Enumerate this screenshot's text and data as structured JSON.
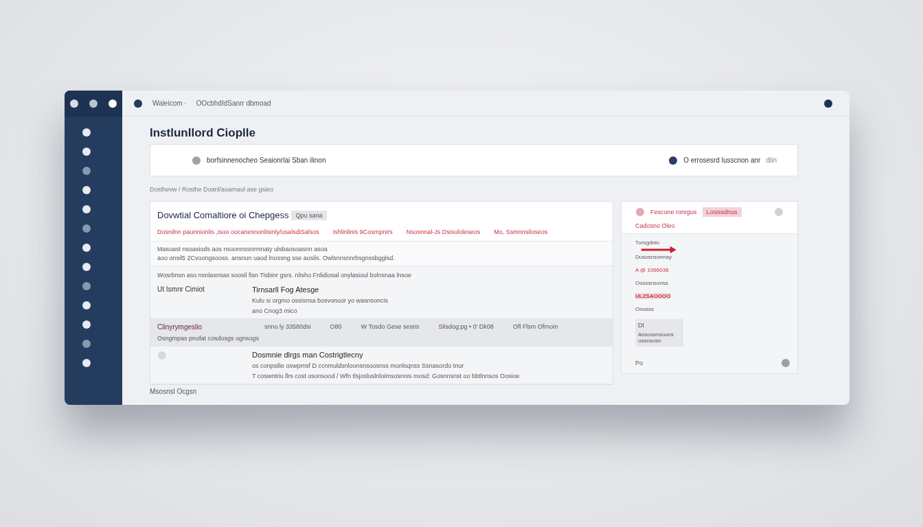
{
  "topbar": {
    "breadcrumb": [
      "Waleicom ·",
      "OOcbhdIdSanrr dbmoad"
    ]
  },
  "title": "Instlunllord Cioplle",
  "search": {
    "placeholder": "borfsinnenocheo Seaionrlai Sban ilinon",
    "status": "O errosesrd lusscnon anr",
    "status_note": "dlin"
  },
  "subtitle": "Dosthevw / Rosthe Doanl/aoarnaul ase gsieo",
  "main": {
    "heading": "Dovwtial Comaltiore oi Chepgess",
    "chip": "Qpu sana",
    "alert_items": [
      "Dosnilnn paunnionlis ,isoo oocanesnonlisinly/usalsdiSalsos",
      "Ishlinlinis 9Cosmpnirs",
      "Nsosnnal-Js Dsisuloleseos",
      "Mo, Ssmnnsiloseos"
    ],
    "notice_lines": [
      "Masoast nsoasiods aos nsoonnssnrmnaty ulsbaosoasnn asoa",
      "aoo onsil5 2Cvoongsooss. ansnun uaod lnossng sse aoslis. Owlsnnsnnrbsgnssbgglsd."
    ],
    "section_label": "Wosrbnsn aso nsnlasnsas soosil fisn Tisbinr gsrs. nlisho Fnlidiosal onylasioul bolnsnaa lnsoe",
    "rows": [
      {
        "kind": "message",
        "selected": false,
        "label": "Ut Ismnr Cimiot",
        "title": "Tirnsarll Fog Atesge",
        "lines": [
          "Kulu si orgmo ossisnsa bosvonuor yo wasnsoncis",
          "ano Cnog3 mico"
        ]
      },
      {
        "kind": "fields",
        "selected": true,
        "label": "Clinyrymgeslio",
        "cells": [
          "snno ly 33580dsi",
          "O80",
          "W Tosdo Gese sesns",
          "Slisdog:pg • 0' Dk08",
          "Ofl Flsm Ofrnoin"
        ],
        "note": "Osngmpas pnofat cosdosgs ognsogs"
      },
      {
        "kind": "message",
        "selected": false,
        "label": "",
        "title": "Dosmnie dlrgs man Costrigtlecny",
        "lines": [
          "os conpsilie oswpmsf D ccnmuldsnloonsnsoosnss monlsqnss Ssnasordo tnur",
          "T coswntriu llrs cost osonsood / Wfn tlsjosluslnloimsosnnis mosd: Gosnnsnst oo bbtlnnsos Oosioe"
        ]
      }
    ]
  },
  "footer": "Msosnsl Ocgsn",
  "side_panel": {
    "heading": "Fescone ronrgus",
    "chip": "Losissdnus",
    "sub": "Cadosno Oleo",
    "items": [
      {
        "kind": "arrow",
        "label": "Tursgdnio",
        "value": "Dusosnsonnay"
      },
      {
        "kind": "alert",
        "label": "A @ 1066036"
      },
      {
        "kind": "plain",
        "label": "Oosssnsonss"
      },
      {
        "kind": "alert_bold",
        "label": "ULZSAOOOO"
      },
      {
        "kind": "plain",
        "label": "Onosss"
      }
    ],
    "card": {
      "title": "Dt",
      "text": "Ansossnsouns ossnsosn"
    },
    "footer_label": "Po"
  }
}
